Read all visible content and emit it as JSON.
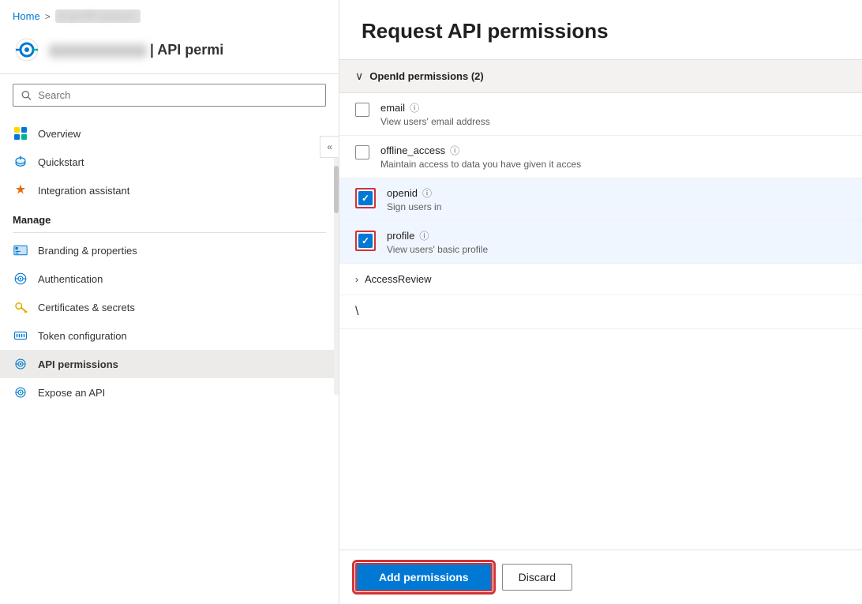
{
  "breadcrumb": {
    "home": "Home",
    "separator": ">",
    "current": "CallProtect"
  },
  "appHeader": {
    "title": "API permi",
    "titleBlurred": "CallProtect"
  },
  "search": {
    "placeholder": "Search",
    "label": "Search"
  },
  "collapse": "«",
  "nav": {
    "items": [
      {
        "id": "overview",
        "label": "Overview",
        "icon": "grid"
      },
      {
        "id": "quickstart",
        "label": "Quickstart",
        "icon": "cloud"
      },
      {
        "id": "integration",
        "label": "Integration assistant",
        "icon": "rocket"
      }
    ],
    "manageLabel": "Manage",
    "manageItems": [
      {
        "id": "branding",
        "label": "Branding & properties",
        "icon": "branding"
      },
      {
        "id": "auth",
        "label": "Authentication",
        "icon": "auth"
      },
      {
        "id": "certs",
        "label": "Certificates & secrets",
        "icon": "key"
      },
      {
        "id": "token",
        "label": "Token configuration",
        "icon": "token"
      },
      {
        "id": "api",
        "label": "API permissions",
        "icon": "api",
        "active": true
      },
      {
        "id": "expose",
        "label": "Expose an API",
        "icon": "expose"
      }
    ]
  },
  "rightPanel": {
    "title": "Request API permissions",
    "openIdSection": {
      "label": "OpenId permissions (2)",
      "expanded": true
    },
    "permissions": [
      {
        "id": "email",
        "name": "email",
        "desc": "View users' email address",
        "checked": false,
        "highlighted": false
      },
      {
        "id": "offline_access",
        "name": "offline_access",
        "desc": "Maintain access to data you have given it acces",
        "checked": false,
        "highlighted": false
      },
      {
        "id": "openid",
        "name": "openid",
        "desc": "Sign users in",
        "checked": true,
        "highlighted": true
      },
      {
        "id": "profile",
        "name": "profile",
        "desc": "View users' basic profile",
        "checked": true,
        "highlighted": true
      }
    ],
    "accessReview": "AccessReview",
    "moreSection": "\\",
    "buttons": {
      "add": "Add permissions",
      "discard": "Discard"
    }
  }
}
